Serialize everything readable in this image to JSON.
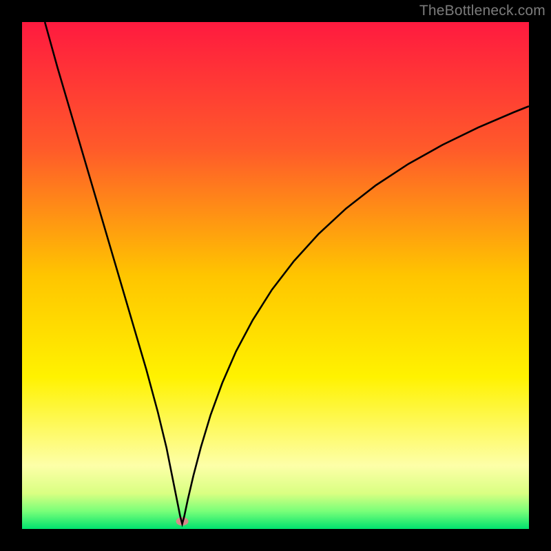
{
  "watermark": "TheBottleneck.com",
  "chart_data": {
    "type": "line",
    "title": "",
    "xlabel": "",
    "ylabel": "",
    "xlim": [
      0,
      100
    ],
    "ylim": [
      0,
      100
    ],
    "grid": false,
    "legend": false,
    "x_min_position_fraction": 0.315,
    "background_gradient": [
      {
        "stop": 0.0,
        "color": "#ff1a3f"
      },
      {
        "stop": 0.25,
        "color": "#ff5a2a"
      },
      {
        "stop": 0.5,
        "color": "#ffc500"
      },
      {
        "stop": 0.7,
        "color": "#fff200"
      },
      {
        "stop": 0.875,
        "color": "#fdffa8"
      },
      {
        "stop": 0.93,
        "color": "#d9ff82"
      },
      {
        "stop": 0.965,
        "color": "#79ff79"
      },
      {
        "stop": 1.0,
        "color": "#00e26e"
      }
    ],
    "marker": {
      "x_fraction": 0.316,
      "y_fraction": 0.985,
      "color": "#d88a8a",
      "rx": 9,
      "ry": 6
    },
    "series": [
      {
        "name": "curve",
        "color": "#000000",
        "points_fraction": [
          [
            0.045,
            0.0
          ],
          [
            0.07,
            0.09
          ],
          [
            0.095,
            0.175
          ],
          [
            0.12,
            0.26
          ],
          [
            0.145,
            0.345
          ],
          [
            0.17,
            0.43
          ],
          [
            0.195,
            0.515
          ],
          [
            0.22,
            0.6
          ],
          [
            0.245,
            0.685
          ],
          [
            0.268,
            0.77
          ],
          [
            0.285,
            0.84
          ],
          [
            0.297,
            0.9
          ],
          [
            0.306,
            0.945
          ],
          [
            0.312,
            0.975
          ],
          [
            0.316,
            0.99
          ],
          [
            0.32,
            0.975
          ],
          [
            0.327,
            0.942
          ],
          [
            0.338,
            0.895
          ],
          [
            0.353,
            0.838
          ],
          [
            0.372,
            0.775
          ],
          [
            0.395,
            0.712
          ],
          [
            0.422,
            0.65
          ],
          [
            0.455,
            0.588
          ],
          [
            0.493,
            0.528
          ],
          [
            0.536,
            0.472
          ],
          [
            0.585,
            0.418
          ],
          [
            0.639,
            0.368
          ],
          [
            0.698,
            0.322
          ],
          [
            0.762,
            0.28
          ],
          [
            0.83,
            0.242
          ],
          [
            0.9,
            0.208
          ],
          [
            0.97,
            0.178
          ],
          [
            1.0,
            0.166
          ]
        ]
      }
    ]
  }
}
